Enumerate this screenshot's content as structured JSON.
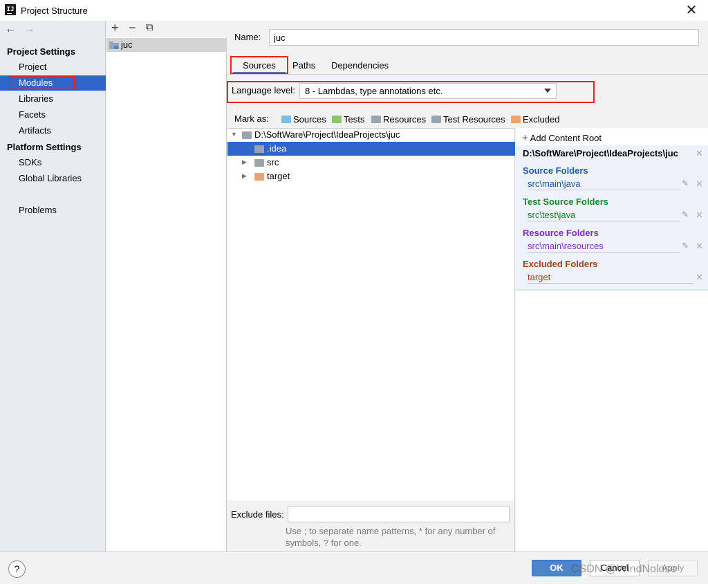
{
  "window": {
    "title": "Project Structure",
    "close": "✕"
  },
  "nav": {
    "back": "←",
    "forward": "→",
    "project_settings_title": "Project Settings",
    "project_settings": [
      "Project",
      "Modules",
      "Libraries",
      "Facets",
      "Artifacts"
    ],
    "platform_settings_title": "Platform Settings",
    "platform_settings": [
      "SDKs",
      "Global Libraries"
    ],
    "problems": "Problems",
    "selected": "Modules"
  },
  "module_list": {
    "add": "+",
    "remove": "−",
    "copy": "⧉",
    "modules": [
      "juc"
    ]
  },
  "name_field": {
    "label": "Name:",
    "value": "juc"
  },
  "tabs": [
    "Sources",
    "Paths",
    "Dependencies"
  ],
  "language_level": {
    "label": "Language level:",
    "value": "8 - Lambdas, type annotations etc."
  },
  "mark_as": {
    "label": "Mark as:",
    "items": [
      {
        "label": "Sources",
        "color": "#7bbde5"
      },
      {
        "label": "Tests",
        "color": "#8cc46b"
      },
      {
        "label": "Resources",
        "color": "#9aa4ad"
      },
      {
        "label": "Test Resources",
        "color": "#9aa4ad"
      },
      {
        "label": "Excluded",
        "color": "#f0a36c"
      }
    ]
  },
  "tree": {
    "root": "D:\\SoftWare\\Project\\IdeaProjects\\juc",
    "children": [
      ".idea",
      "src",
      "target"
    ],
    "selected": ".idea"
  },
  "exclude_files": {
    "label": "Exclude files:",
    "value": "",
    "hint": "Use ; to separate name patterns, * for any number of symbols, ? for one."
  },
  "content_root": {
    "add_label": "Add Content Root",
    "path": "D:\\SoftWare\\Project\\IdeaProjects\\juc",
    "groups": [
      {
        "title": "Source Folders",
        "color": "#1f57a5",
        "path": "src\\main\\java"
      },
      {
        "title": "Test Source Folders",
        "color": "#12862e",
        "path": "src\\test\\java"
      },
      {
        "title": "Resource Folders",
        "color": "#7a2fc2",
        "path": "src\\main\\resources"
      },
      {
        "title": "Excluded Folders",
        "color": "#a63d12",
        "path": "target"
      }
    ]
  },
  "buttons": {
    "help": "?",
    "ok": "OK",
    "cancel": "Cancel",
    "apply": "Apply"
  },
  "watermark": "CSDN @WindNolose"
}
